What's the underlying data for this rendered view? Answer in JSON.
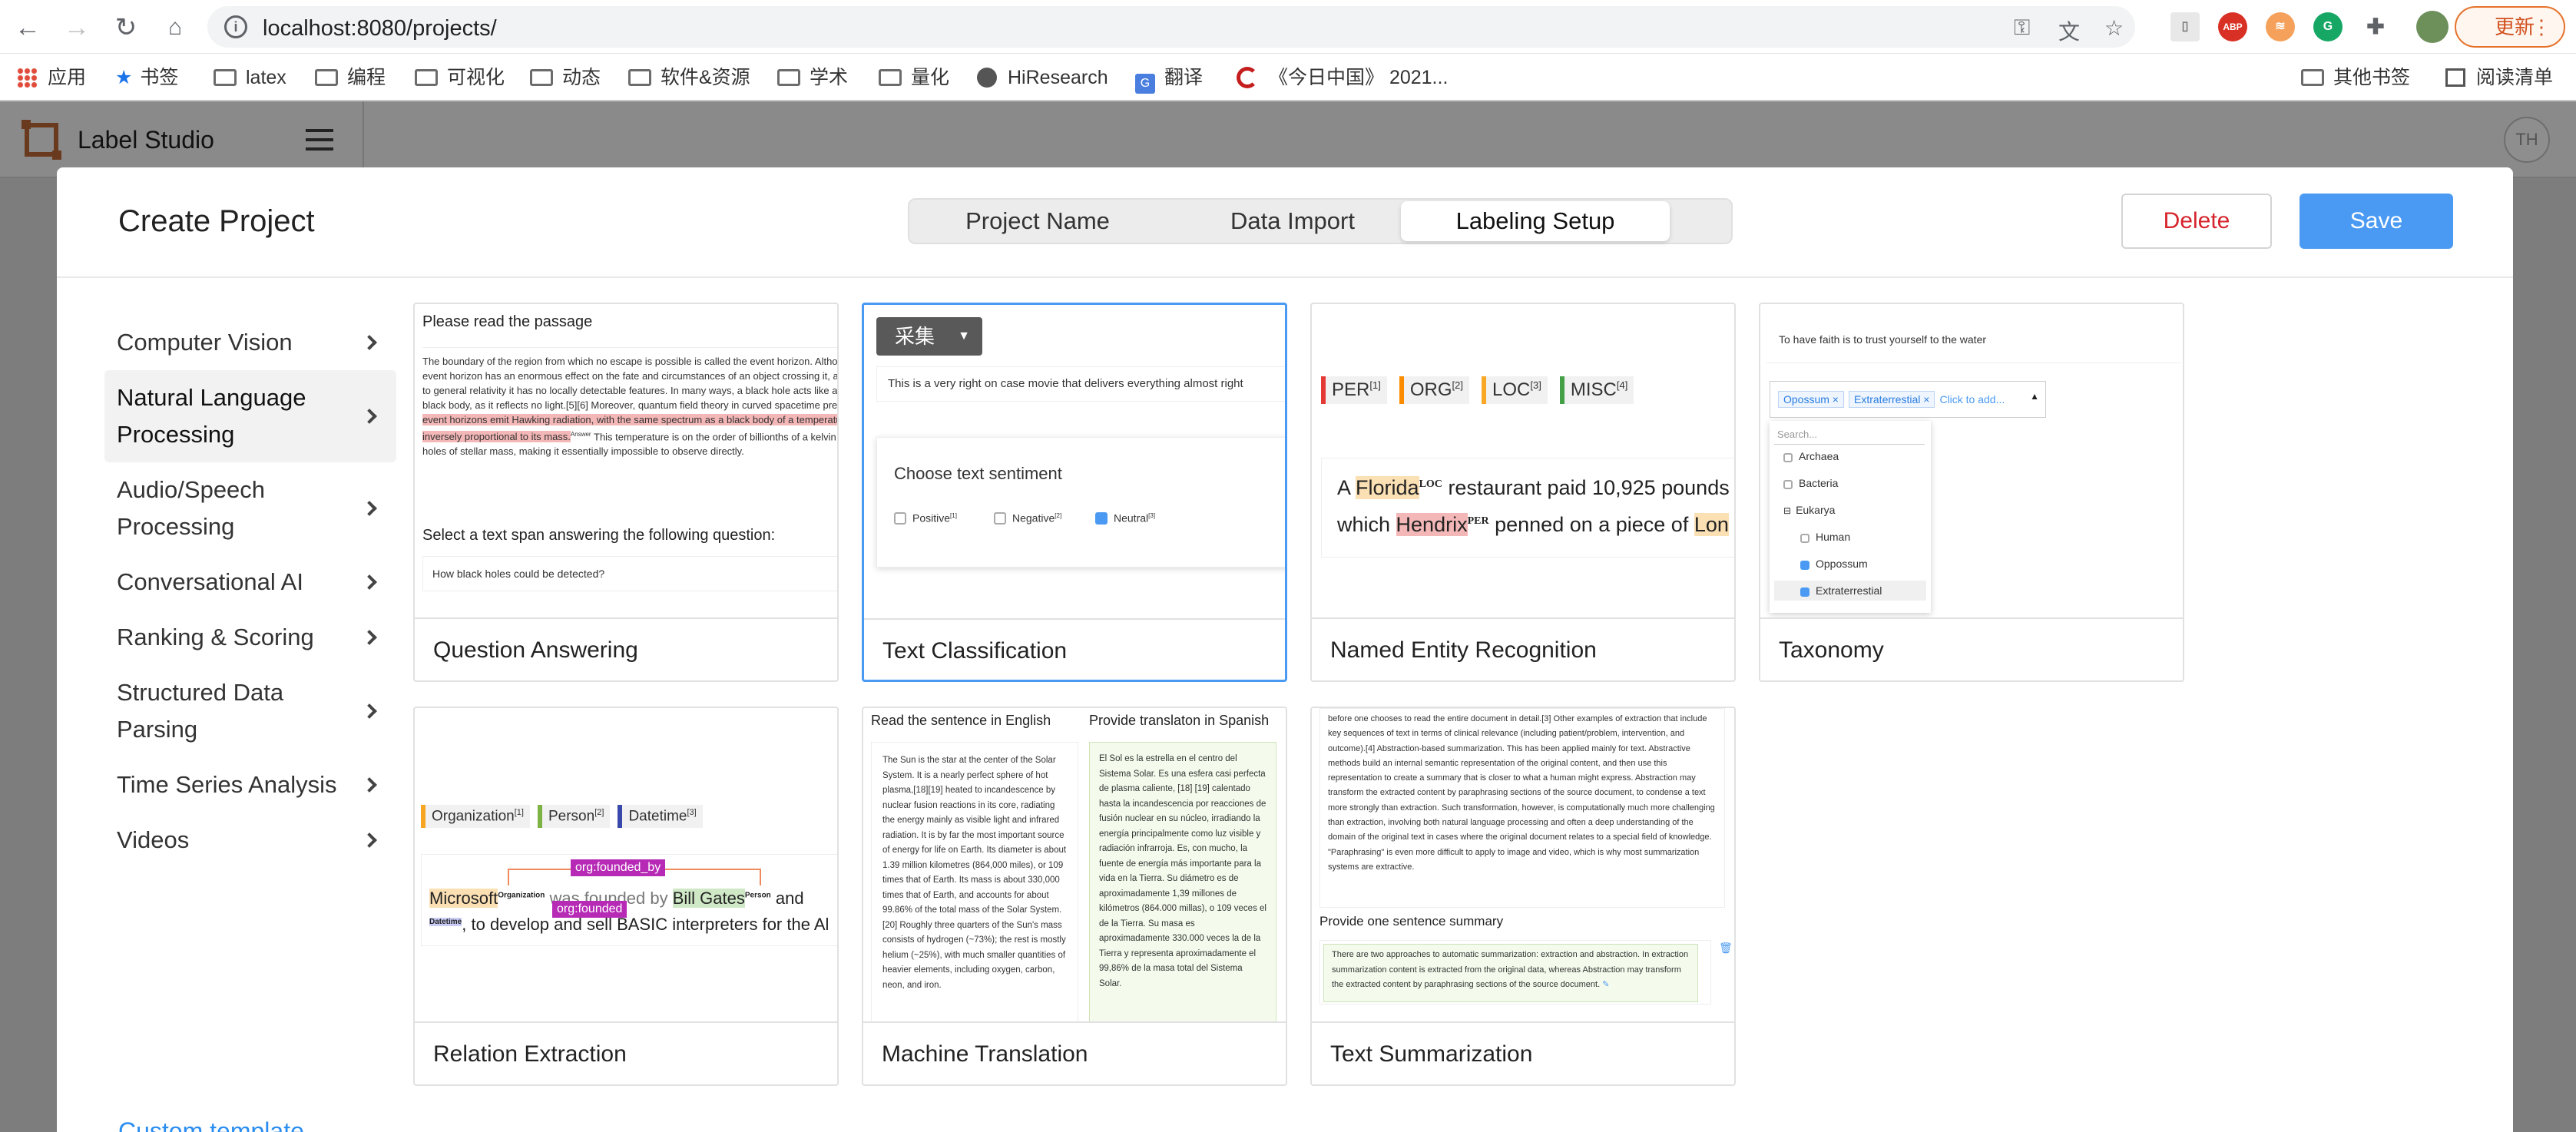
{
  "browser": {
    "url": "localhost:8080/projects/",
    "update_label": "更新",
    "bookmarks": [
      "应用",
      "书签",
      "latex",
      "编程",
      "可视化",
      "动态",
      "软件&资源",
      "学术",
      "量化",
      "HiResearch",
      "翻译",
      "《今日中国》 2021...",
      "其他书签",
      "阅读清单"
    ]
  },
  "app": {
    "brand": "Label Studio",
    "avatar_initials": "TH"
  },
  "modal": {
    "title": "Create Project",
    "tabs": [
      "Project Name",
      "Data Import",
      "Labeling Setup"
    ],
    "active_tab": "Labeling Setup",
    "delete_label": "Delete",
    "save_label": "Save"
  },
  "sidebar": {
    "items": [
      {
        "label": "Computer Vision"
      },
      {
        "label": "Natural Language Processing"
      },
      {
        "label": "Audio/Speech Processing"
      },
      {
        "label": "Conversational AI"
      },
      {
        "label": "Ranking & Scoring"
      },
      {
        "label": "Structured Data Parsing"
      },
      {
        "label": "Time Series Analysis"
      },
      {
        "label": "Videos"
      }
    ],
    "active": "Natural Language Processing",
    "custom_template": "Custom template"
  },
  "cards": [
    {
      "title": "Question Answering",
      "instruction": "Please read the passage",
      "passage_before": "The boundary of the region from which no escape is possible is called the event horizon. Although the event horizon has an enormous effect on the fate and circumstances of an object crossing it, according to general relativity it has no locally detectable features. In many ways, a black hole acts like an ideal black body, as it reflects no light.[5][6] Moreover, quantum field theory in curved spacetime predicts that",
      "passage_highlight": "event horizons emit Hawking radiation, with the same spectrum as a black body of a temperature inversely proportional to its mass.",
      "highlight_label": "Answer",
      "passage_after": "This temperature is on the order of billionths of a kelvin for black holes of stellar mass, making it essentially impossible to observe directly.",
      "question_prompt": "Select a text span answering the following question:",
      "question": "How black holes could be detected?"
    },
    {
      "title": "Text Classification",
      "dropdown_label": "采集",
      "text": "This is a very right on case movie that delivers everything almost right",
      "prompt": "Choose text sentiment",
      "choices": [
        {
          "label": "Positive",
          "hotkey": "1",
          "checked": false
        },
        {
          "label": "Negative",
          "hotkey": "2",
          "checked": false
        },
        {
          "label": "Neutral",
          "hotkey": "3",
          "checked": true
        }
      ]
    },
    {
      "title": "Named Entity Recognition",
      "labels": [
        {
          "name": "PER",
          "hotkey": "1",
          "color": "#e53935"
        },
        {
          "name": "ORG",
          "hotkey": "2",
          "color": "#fb8c00"
        },
        {
          "name": "LOC",
          "hotkey": "3",
          "color": "#f9a825"
        },
        {
          "name": "MISC",
          "hotkey": "4",
          "color": "#43a047"
        }
      ],
      "sentence_parts": [
        "A",
        "Florida",
        "LOC",
        "restaurant paid 10,925 pounds",
        "which",
        "Hendrix",
        "PER",
        "penned on a piece of",
        "Lon"
      ]
    },
    {
      "title": "Taxonomy",
      "text": "To have faith is to trust yourself to the water",
      "selected_tags": [
        "Opossum",
        "Extraterrestial"
      ],
      "click_to_add": "Click to add...",
      "search_placeholder": "Search...",
      "tree": [
        {
          "label": "Archaea",
          "checked": false,
          "level": 0
        },
        {
          "label": "Bacteria",
          "checked": false,
          "level": 0
        },
        {
          "label": "Eukarya",
          "checked": false,
          "level": 0,
          "expanded": true
        },
        {
          "label": "Human",
          "checked": false,
          "level": 1
        },
        {
          "label": "Oppossum",
          "checked": true,
          "level": 1
        },
        {
          "label": "Extraterrestial",
          "checked": true,
          "level": 1
        }
      ]
    },
    {
      "title": "Relation Extraction",
      "labels": [
        {
          "name": "Organization",
          "hotkey": "1",
          "color": "#f6a623"
        },
        {
          "name": "Person",
          "hotkey": "2",
          "color": "#7cb342"
        },
        {
          "name": "Datetime",
          "hotkey": "3",
          "color": "#3949ab"
        }
      ],
      "relation_top": "org:founded_by",
      "relation_bottom": "org:founded",
      "parts": {
        "org": "Microsoft",
        "org_label": "Organization",
        "mid": "was founded by",
        "person": "Bill Gates",
        "person_label": "Person",
        "and": "and",
        "date_label": "Datetime",
        "rest": "to develop and sell BASIC interpreters for the Al"
      }
    },
    {
      "title": "Machine Translation",
      "left_header": "Read the sentence in English",
      "right_header": "Provide translaton in Spanish",
      "english": "The Sun is the star at the center of the Solar System. It is a nearly perfect sphere of hot plasma,[18][19] heated to incandescence by nuclear fusion reactions in its core, radiating the energy mainly as visible light and infrared radiation. It is by far the most important source of energy for life on Earth. Its diameter is about 1.39 million kilometres (864,000 miles), or 109 times that of Earth. Its mass is about 330,000 times that of Earth, and accounts for about 99.86% of the total mass of the Solar System.[20] Roughly three quarters of the Sun's mass consists of hydrogen (~73%); the rest is mostly helium (~25%), with much smaller quantities of heavier elements, including oxygen, carbon, neon, and iron.",
      "spanish": "El Sol es la estrella en el centro del Sistema Solar. Es una esfera casi perfecta de plasma caliente, [18] [19] calentado hasta la incandescencia por reacciones de fusión nuclear en su núcleo, irradiando la energía principalmente como luz visible y radiación infrarroja. Es, con mucho, la fuente de energía más importante para la vida en la Tierra. Su diámetro es de aproximadamente 1,39 millones de kilómetros (864.000 millas), o 109 veces el de la Tierra. Su masa es aproximadamente 330.000 veces la de la Tierra y representa aproximadamente el 99,86% de la masa total del Sistema Solar."
    },
    {
      "title": "Text Summarization",
      "text": "before one chooses to read the entire document in detail.[3] Other examples of extraction that include key sequences of text in terms of clinical relevance (including patient/problem, intervention, and outcome).[4] Abstraction-based summarization. This has been applied mainly for text. Abstractive methods build an internal semantic representation of the original content, and then use this representation to create a summary that is closer to what a human might express. Abstraction may transform the extracted content by paraphrasing sections of the source document, to condense a text more strongly than extraction. Such transformation, however, is computationally much more challenging than extraction, involving both natural language processing and often a deep understanding of the domain of the original text in cases where the original document relates to a special field of knowledge. \"Paraphrasing\" is even more difficult to apply to image and video, which is why most summarization systems are extractive.",
      "prompt": "Provide one sentence summary",
      "summary": "There are two approaches to automatic summarization: extraction and abstraction. In extraction summarization content is extracted from the original data, whereas Abstraction may transform the extracted content by paraphrasing sections of the source document."
    }
  ]
}
